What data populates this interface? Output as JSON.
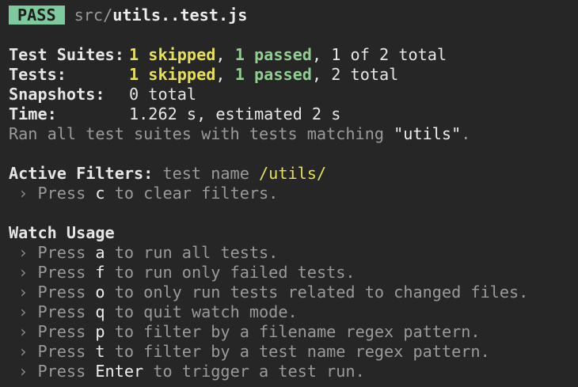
{
  "header": {
    "badge": "PASS",
    "path_prefix": "src/",
    "file_name": "utils..test.js"
  },
  "summary": {
    "suites_label": "Test Suites:",
    "suites_skipped": "1 skipped",
    "suites_passed": "1 passed",
    "suites_rest": ", 1 of 2 total",
    "tests_label": "Tests:",
    "tests_skipped": "1 skipped",
    "tests_passed": "1 passed",
    "tests_rest": ", 2 total",
    "snapshots_label": "Snapshots:",
    "snapshots_value": "0 total",
    "time_label": "Time:",
    "time_value": "1.262 s, estimated 2 s",
    "ran_prefix": "Ran all test suites with tests matching ",
    "ran_pattern": "\"utils\"",
    "ran_suffix": "."
  },
  "filters": {
    "title": "Active Filters:",
    "desc": "test name ",
    "pattern": "/utils/",
    "clear_prefix": "Press ",
    "clear_key": "c",
    "clear_suffix": " to clear filters."
  },
  "watch": {
    "title": "Watch Usage",
    "items": [
      {
        "key": "a",
        "text": " to run all tests."
      },
      {
        "key": "f",
        "text": " to run only failed tests."
      },
      {
        "key": "o",
        "text": " to only run tests related to changed files."
      },
      {
        "key": "q",
        "text": " to quit watch mode."
      },
      {
        "key": "p",
        "text": " to filter by a filename regex pattern."
      },
      {
        "key": "t",
        "text": " to filter by a test name regex pattern."
      },
      {
        "key": "Enter",
        "text": " to trigger a test run."
      }
    ],
    "press": "Press ",
    "arrow": "›"
  },
  "colors": {
    "background": "#262626",
    "pass_badge": "#7fc99e",
    "skipped": "#e5e057",
    "passed": "#8fcf8f",
    "dim": "#9a9a9a"
  }
}
